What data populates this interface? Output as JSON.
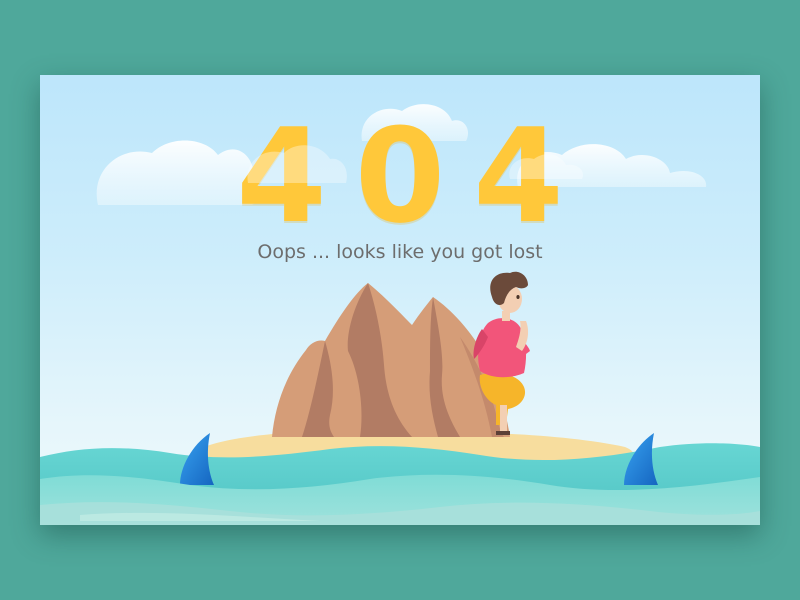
{
  "error_page": {
    "code": "404",
    "message": "Oops ... looks like you got lost"
  },
  "illustration": {
    "subjects": [
      "cloud-icon",
      "rock-icon",
      "person-icon",
      "shark-fin-icon",
      "sea-wave-icon"
    ]
  },
  "colors": {
    "page_background": "#4fa89b",
    "sky_top": "#bde6fb",
    "sky_bottom": "#eefafb",
    "code_yellow": "#ffc83a",
    "message_gray": "#6d6d6d",
    "rock": "#d59d78",
    "rock_shadow": "#b27c64",
    "sand": "#f7dd9e",
    "sea": "#5fcfd0",
    "shark_fin": "#1e88e5",
    "shirt": "#f2557a",
    "shorts": "#f6b52a"
  }
}
